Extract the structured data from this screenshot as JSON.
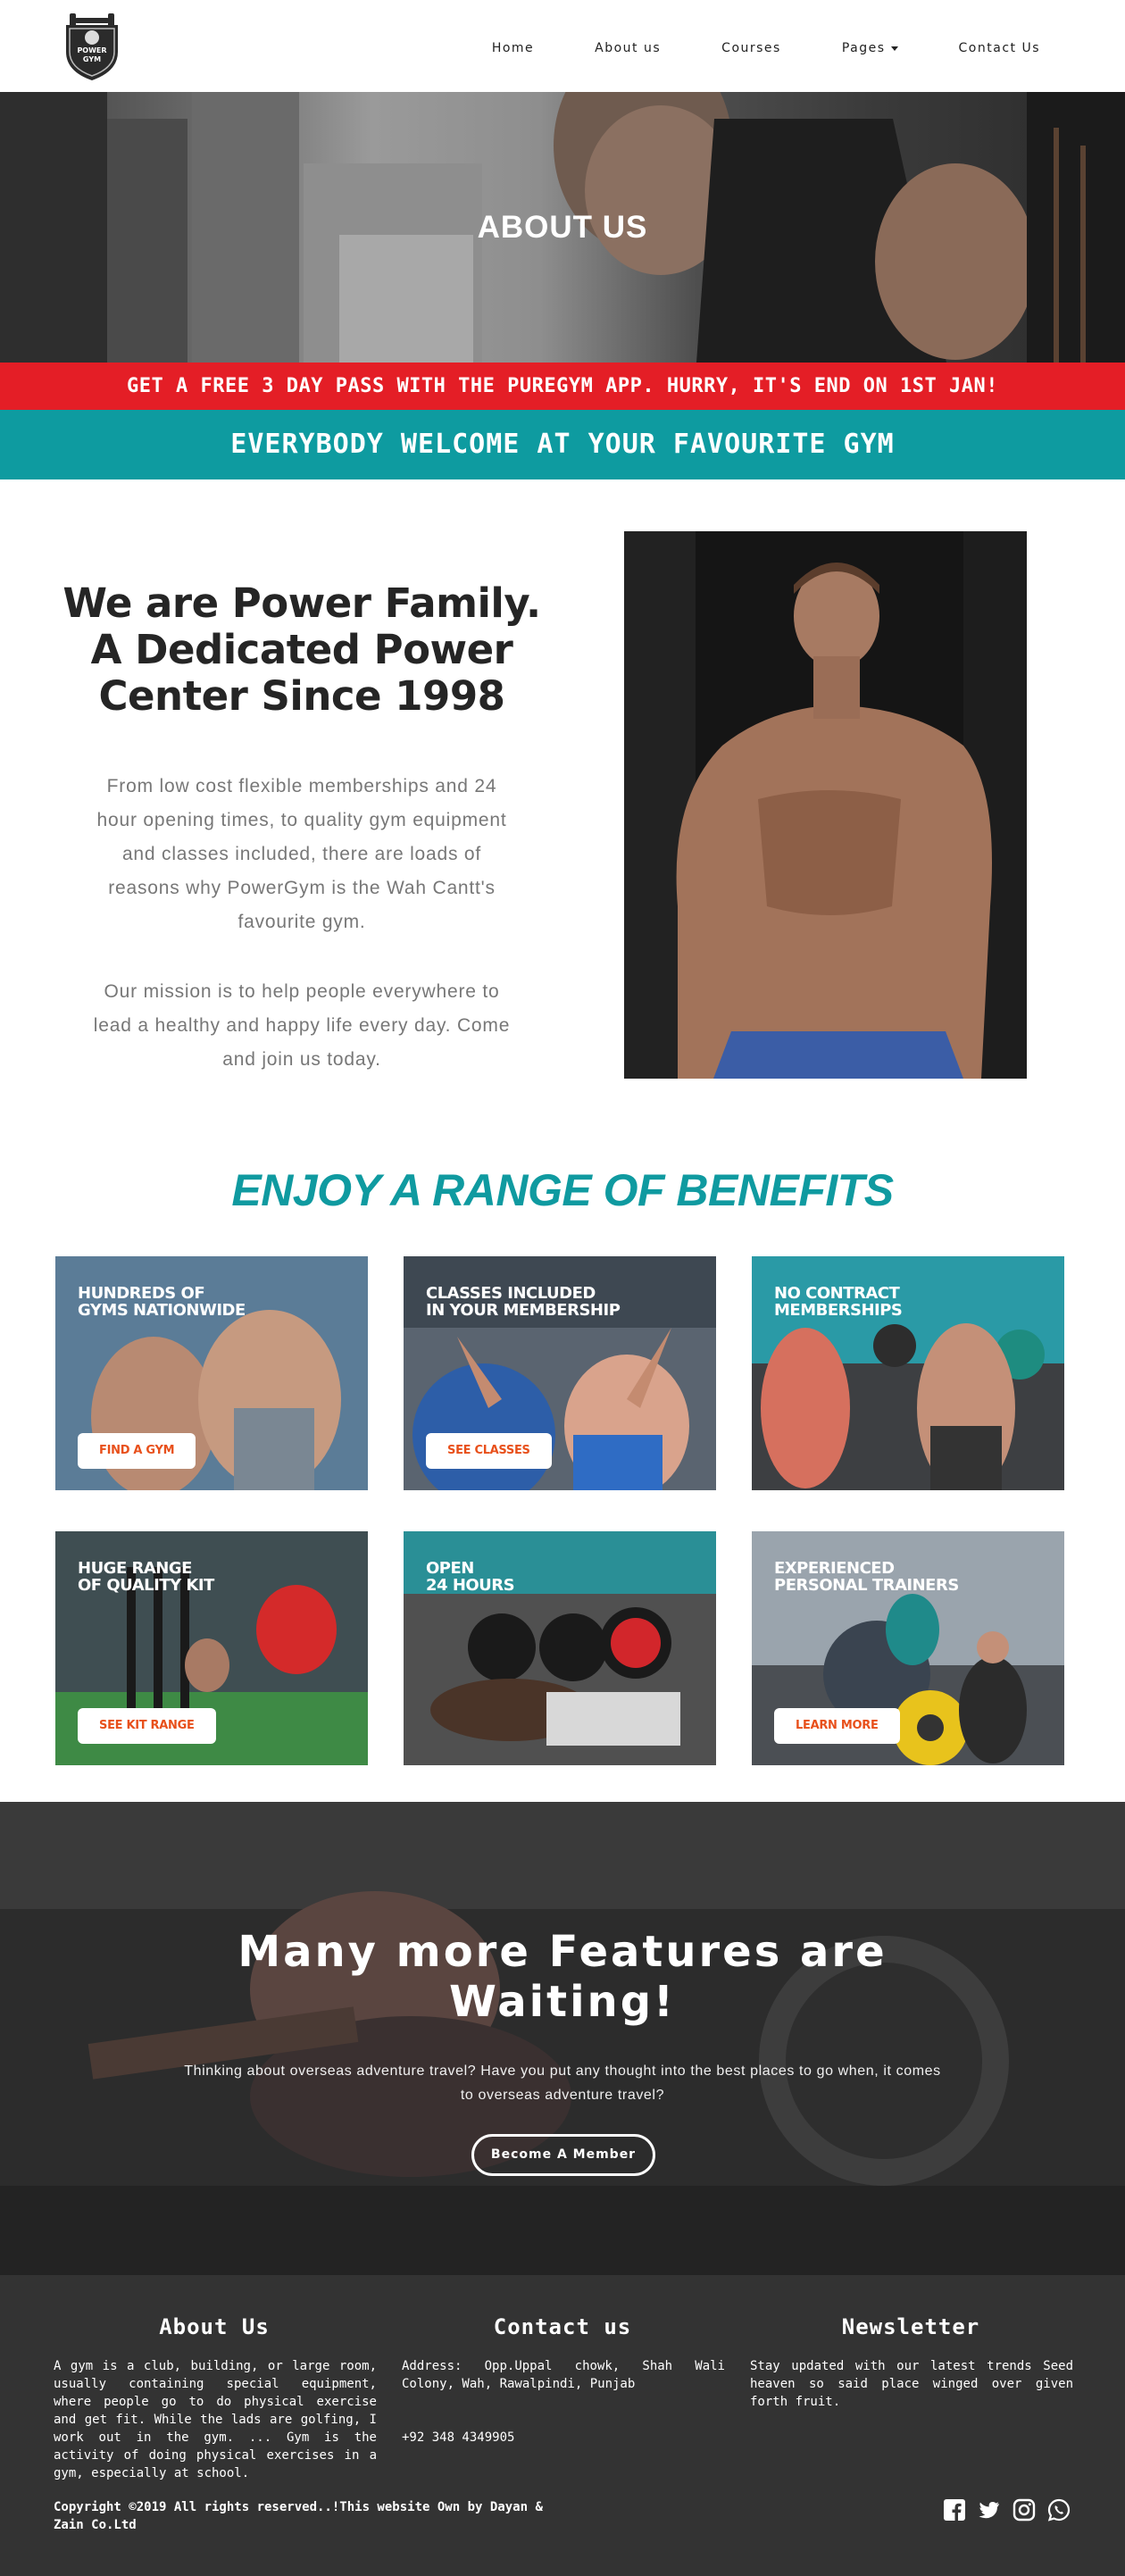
{
  "nav": {
    "logo_text": "POWER GYM",
    "links": [
      {
        "label": "Home"
      },
      {
        "label": "About us"
      },
      {
        "label": "Courses"
      },
      {
        "label": "Pages"
      },
      {
        "label": "Contact Us"
      }
    ]
  },
  "hero": {
    "title": "ABOUT US"
  },
  "promo": {
    "text": "GET A FREE 3 DAY PASS WITH THE PUREGYM APP. HURRY, IT'S END ON 1ST JAN!"
  },
  "welcome": {
    "text": "EVERYBODY WELCOME AT YOUR FAVOURITE GYM"
  },
  "about": {
    "heading_lines": [
      "We are Power Family.",
      "A Dedicated Power",
      "Center Since 1998"
    ],
    "paragraph1": "From low cost flexible memberships and 24 hour opening times, to quality gym equipment and classes included, there are loads of reasons why PowerGym is the Wah Cantt's favourite gym.",
    "paragraph2": "Our mission is to help people everywhere to lead a healthy and happy life every day. Come and join us today."
  },
  "benefits": {
    "title": "ENJOY A RANGE OF BENEFITS",
    "cards": [
      {
        "label_line1": "HUNDREDS OF",
        "label_line2": "GYMS NATIONWIDE",
        "button": "FIND A GYM"
      },
      {
        "label_line1": "CLASSES INCLUDED",
        "label_line2": "IN YOUR MEMBERSHIP",
        "button": "SEE CLASSES"
      },
      {
        "label_line1": "NO CONTRACT",
        "label_line2": "MEMBERSHIPS",
        "button": ""
      },
      {
        "label_line1": "HUGE RANGE",
        "label_line2": "OF QUALITY KIT",
        "button": "SEE KIT RANGE"
      },
      {
        "label_line1": "OPEN",
        "label_line2": "24 HOURS",
        "button": ""
      },
      {
        "label_line1": "EXPERIENCED",
        "label_line2": "PERSONAL TRAINERS",
        "button": "LEARN MORE"
      }
    ]
  },
  "features": {
    "title_line1": "Many more Features are",
    "title_line2": "Waiting!",
    "text": "Thinking about overseas adventure travel? Have you put any thought into the best places to go when, it comes to overseas adventure travel?",
    "button": "Become A Member"
  },
  "footer": {
    "about_title": "About Us",
    "about_text": "A gym is a club, building, or large room, usually containing special equipment, where people go to do physical exercise and get fit. While the lads are golfing, I work out in the gym. ... Gym is the activity of doing physical exercises in a gym, especially at school.",
    "contact_title": "Contact us",
    "contact_address": "Address: Opp.Uppal chowk, Shah Wali Colony, Wah, Rawalpindi, Punjab",
    "contact_phone": "+92 348 4349905",
    "newsletter_title": "Newsletter",
    "newsletter_text": "Stay updated with our latest trends Seed heaven so said place winged over given forth fruit.",
    "copyright": "Copyright ©2019 All rights reserved..!This website Own by Dayan & Zain Co.Ltd",
    "socials": [
      "facebook-icon",
      "twitter-icon",
      "instagram-icon",
      "whatsapp-icon"
    ]
  },
  "colors": {
    "accent_teal": "#0e9ba0",
    "promo_red": "#e41e26",
    "button_orange": "#e8501b",
    "footer_bg": "#333333"
  }
}
